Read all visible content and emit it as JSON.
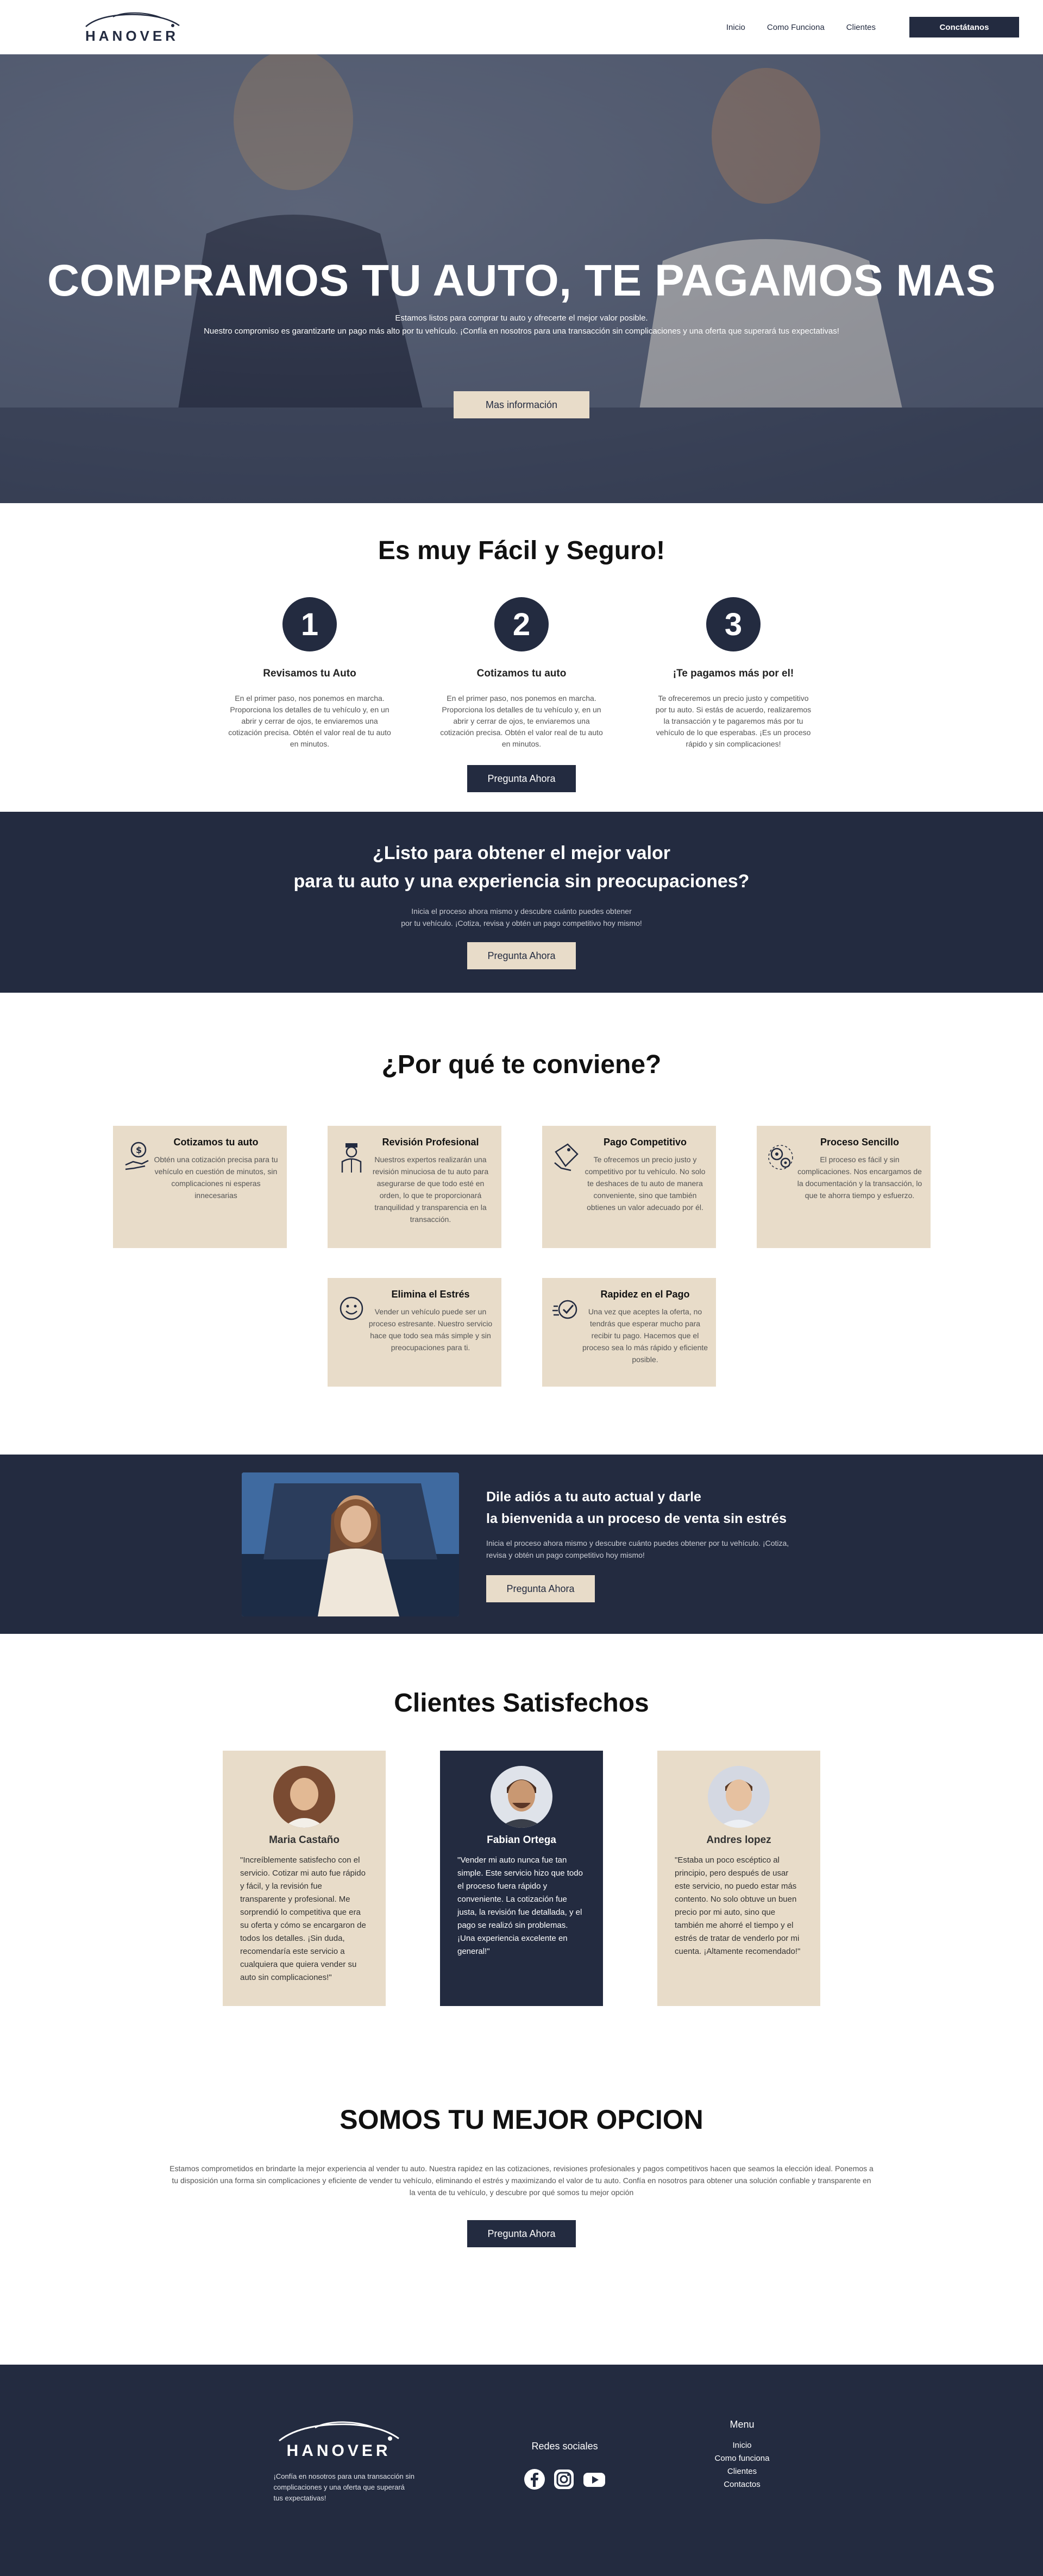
{
  "nav": {
    "logo_text": "HANOVER",
    "links": [
      "Inicio",
      "Como Funciona",
      "Clientes"
    ],
    "cta": "Conctátanos"
  },
  "hero": {
    "title": "COMPRAMOS TU AUTO, TE PAGAMOS MAS",
    "line1": "Estamos listos para comprar tu auto y ofrecerte el mejor valor posible.",
    "line2": "Nuestro compromiso es garantizarte un pago más alto por tu vehículo. ¡Confía en nosotros para una transacción sin complicaciones y una oferta que superará tus expectativas!",
    "button": "Mas información"
  },
  "steps": {
    "title": "Es muy Fácil y Seguro!",
    "items": [
      {
        "number": "1",
        "title": "Revisamos tu Auto",
        "text": "En el primer paso, nos ponemos en marcha. Proporciona los detalles de tu vehículo y, en un abrir y cerrar de ojos, te enviaremos una cotización precisa. Obtén el valor real de tu auto en minutos."
      },
      {
        "number": "2",
        "title": "Cotizamos tu auto",
        "text": "En el primer paso, nos ponemos en marcha. Proporciona los detalles de tu vehículo y, en un abrir y cerrar de ojos, te enviaremos una cotización precisa. Obtén el valor real de tu auto en minutos."
      },
      {
        "number": "3",
        "title": "¡Te pagamos más por el!",
        "text": "Te ofreceremos un precio justo y competitivo por tu auto. Si estás de acuerdo, realizaremos la transacción y te pagaremos más por tu vehículo de lo que esperabas. ¡Es un proceso rápido y sin complicaciones!"
      }
    ],
    "button": "Pregunta Ahora"
  },
  "cta1": {
    "title_line1": "¿Listo para obtener el mejor valor",
    "title_line2": "para tu auto y una experiencia sin preocupaciones?",
    "text_line1": "Inicia el proceso ahora mismo y descubre cuánto puedes obtener",
    "text_line2": "por tu vehículo. ¡Cotiza, revisa y obtén un pago competitivo hoy mismo!",
    "button": "Pregunta Ahora"
  },
  "benefits": {
    "title": "¿Por qué te conviene?",
    "items": [
      {
        "icon": "money-hand-icon",
        "title": "Cotizamos tu auto",
        "text": "Obtén una cotización precisa para tu vehículo en cuestión de minutos, sin complicaciones ni esperas innecesarias"
      },
      {
        "icon": "mechanic-icon",
        "title": "Revisión Profesional",
        "text": "Nuestros expertos realizarán una revisión minuciosa de tu auto para asegurarse de que todo esté en orden, lo que te proporcionará tranquilidad y transparencia en la transacción."
      },
      {
        "icon": "price-tag-icon",
        "title": "Pago Competitivo",
        "text": "Te ofrecemos un precio justo y competitivo por tu vehículo. No solo te deshaces de tu auto de manera conveniente, sino que también obtienes un valor adecuado por él."
      },
      {
        "icon": "gears-icon",
        "title": "Proceso Sencillo",
        "text": "El proceso es fácil y sin complicaciones. Nos encargamos de la documentación y la transacción, lo que te ahorra tiempo y esfuerzo."
      },
      {
        "icon": "smile-icon",
        "title": "Elimina el Estrés",
        "text": "Vender un vehículo puede ser un proceso estresante. Nuestro servicio hace que todo sea más simple y sin preocupaciones para ti."
      },
      {
        "icon": "fast-check-icon",
        "title": "Rapidez en el Pago",
        "text": "Una vez que aceptes la oferta, no tendrás que esperar mucho para recibir tu pago. Hacemos que el proceso sea lo más rápido y eficiente posible."
      }
    ]
  },
  "cta2": {
    "title_line1": "Dile adiós a tu auto actual y darle",
    "title_line2": "la bienvenida a un proceso de venta sin estrés",
    "text": "Inicia el proceso ahora mismo y descubre cuánto puedes obtener por tu vehículo. ¡Cotiza, revisa y obtén un pago competitivo hoy mismo!",
    "button": "Pregunta Ahora"
  },
  "testimonials": {
    "title": "Clientes Satisfechos",
    "items": [
      {
        "name": "Maria Castaño",
        "quote": "\"Increíblemente satisfecho con el servicio. Cotizar mi auto fue rápido y fácil, y la revisión fue transparente y profesional. Me sorprendió lo competitiva que era su oferta y cómo se encargaron de todos los detalles. ¡Sin duda, recomendaría este servicio a cualquiera que quiera vender su auto sin complicaciones!\""
      },
      {
        "name": "Fabian Ortega",
        "quote": "\"Vender mi auto nunca fue tan simple. Este servicio hizo que todo el proceso fuera rápido y conveniente. La cotización fue justa, la revisión fue detallada, y el pago se realizó sin problemas. ¡Una experiencia excelente en general!\""
      },
      {
        "name": "Andres lopez",
        "quote": "\"Estaba un poco escéptico al principio, pero después de usar este servicio, no puedo estar más contento. No solo obtuve un buen precio por mi auto, sino que también me ahorré el tiempo y el estrés de tratar de venderlo por mi cuenta. ¡Altamente recomendado!\""
      }
    ]
  },
  "best": {
    "title": "SOMOS TU MEJOR OPCION",
    "text": "Estamos comprometidos en brindarte la mejor experiencia al vender tu auto. Nuestra rapidez en las cotizaciones, revisiones profesionales y pagos competitivos hacen que seamos la elección ideal. Ponemos a tu disposición una forma sin complicaciones y eficiente de vender tu vehículo, eliminando el estrés y maximizando el valor de tu auto. Confía en nosotros para obtener una solución confiable y transparente en la venta de tu vehículo, y descubre por qué somos tu mejor opción",
    "button": "Pregunta Ahora"
  },
  "footer": {
    "logo_text": "HANOVER",
    "tagline": "¡Confía en nosotros para una transacción sin complicaciones y una oferta que superará tus expectativas!",
    "social_title": "Redes sociales",
    "menu_title": "Menu",
    "menu": [
      "Inicio",
      "Como funciona",
      "Clientes",
      "Contactos"
    ]
  }
}
